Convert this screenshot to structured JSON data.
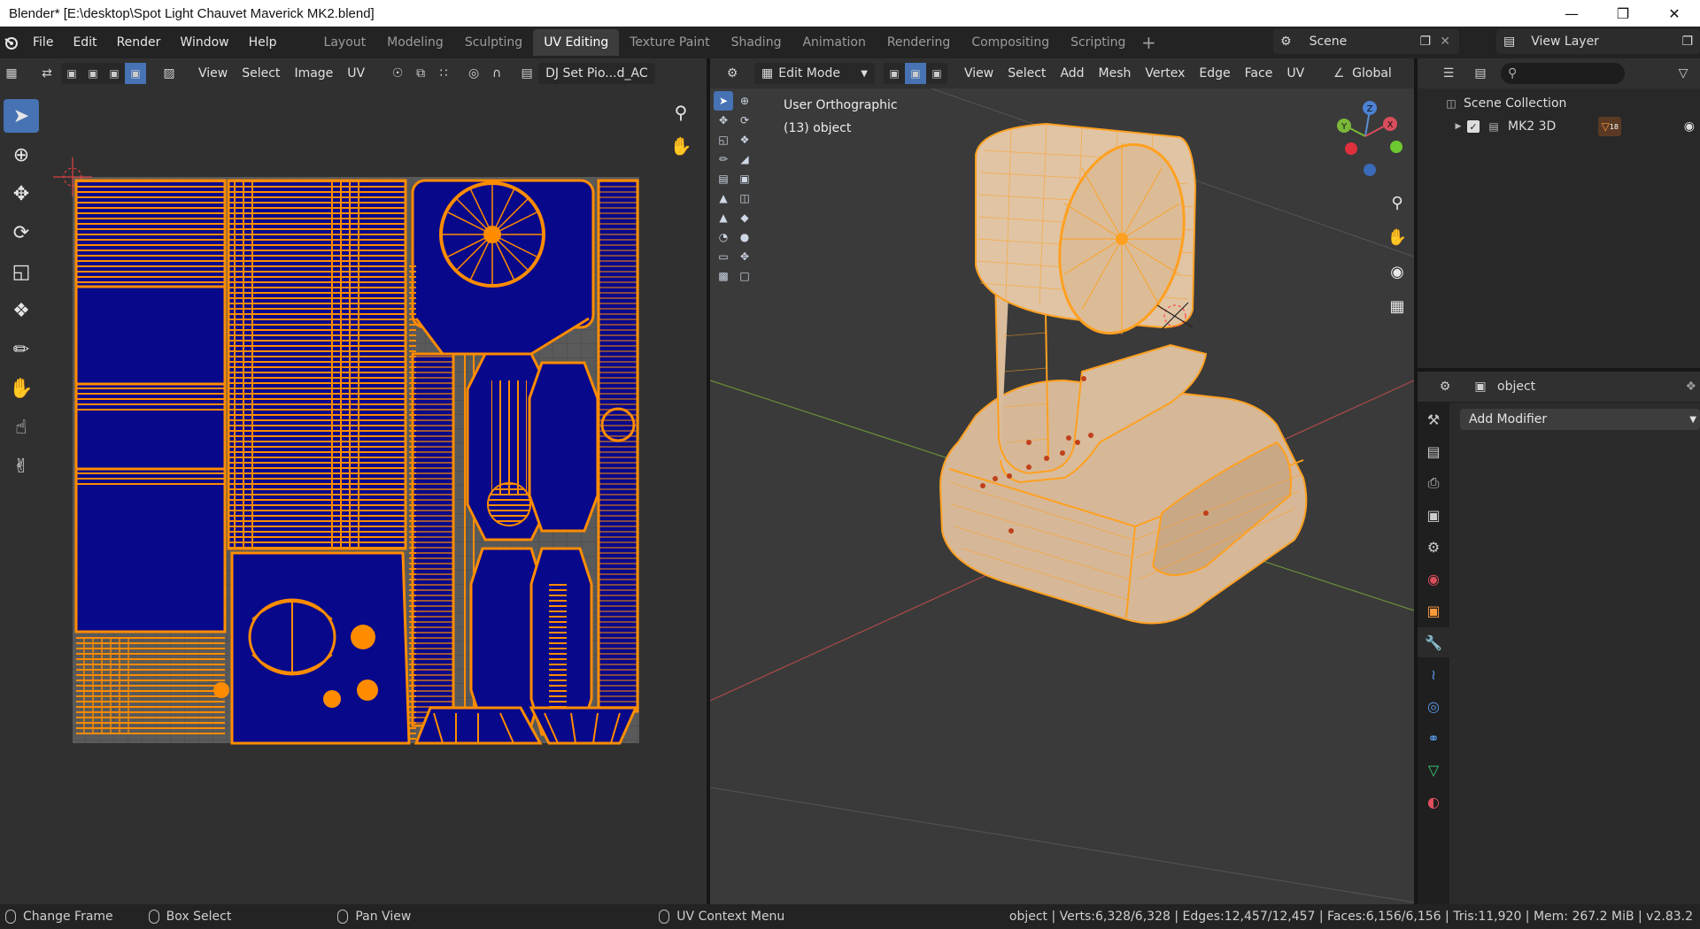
{
  "window": {
    "title": "Blender* [E:\\desktop\\Spot Light Chauvet Maverick MK2.blend]",
    "minimize": "—",
    "restore": "❐",
    "close": "✕"
  },
  "menubar": {
    "items": [
      "File",
      "Edit",
      "Render",
      "Window",
      "Help"
    ],
    "workspaces": [
      "Layout",
      "Modeling",
      "Sculpting",
      "UV Editing",
      "Texture Paint",
      "Shading",
      "Animation",
      "Rendering",
      "Compositing",
      "Scripting"
    ],
    "active_workspace": "UV Editing",
    "add_workspace": "+",
    "scene": "Scene",
    "view_layer": "View Layer"
  },
  "uv_header": {
    "menus": [
      "View",
      "Select",
      "Image",
      "UV"
    ],
    "image_name": "DJ Set Pio...d_AC"
  },
  "viewport_header": {
    "mode": "Edit Mode",
    "menus": [
      "View",
      "Select",
      "Add",
      "Mesh",
      "Vertex",
      "Edge",
      "Face",
      "UV"
    ],
    "orientation": "Global"
  },
  "viewport": {
    "view_name": "User Orthographic",
    "object_info": "(13) object",
    "axes": {
      "x": "X",
      "y": "Y",
      "z": "Z"
    }
  },
  "outliner": {
    "search_placeholder": "",
    "root": "Scene Collection",
    "collection": "MK2 3D",
    "badge_count": "18"
  },
  "properties": {
    "object_name": "object",
    "add_modifier": "Add Modifier"
  },
  "statusbar": {
    "hints": [
      "Change Frame",
      "Box Select",
      "Pan View",
      "UV Context Menu"
    ],
    "stats": "object | Verts:6,328/6,328 | Edges:12,457/12,457 | Faces:6,156/6,156 | Tris:11,920 | Mem: 267.2 MiB | v2.83.2"
  },
  "colors": {
    "accent": "#4772b3",
    "uv_island": "#08088a",
    "uv_edge": "#ff8c00",
    "mesh_wire": "#ffa020"
  }
}
